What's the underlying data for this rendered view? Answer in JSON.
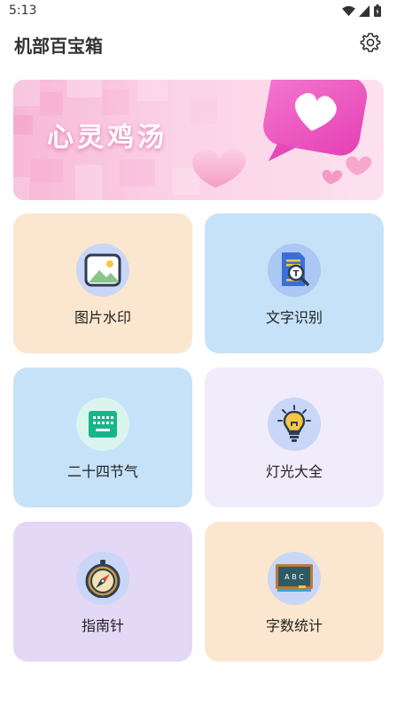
{
  "status": {
    "time": "5:13"
  },
  "app": {
    "title": "机部百宝箱"
  },
  "banner": {
    "text": "心灵鸡汤"
  },
  "tools": [
    {
      "label": "图片水印",
      "icon": "image-icon",
      "bg": "#fbe7cf"
    },
    {
      "label": "文字识别",
      "icon": "document-scan-icon",
      "bg": "#c6e2f8"
    },
    {
      "label": "二十四节气",
      "icon": "keyboard-icon",
      "bg": "#c6e2f8"
    },
    {
      "label": "灯光大全",
      "icon": "lightbulb-icon",
      "bg": "#f0ecfb"
    },
    {
      "label": "指南针",
      "icon": "compass-icon",
      "bg": "#e3d8f5"
    },
    {
      "label": "字数统计",
      "icon": "chalkboard-icon",
      "bg": "#fbe7cf"
    }
  ]
}
